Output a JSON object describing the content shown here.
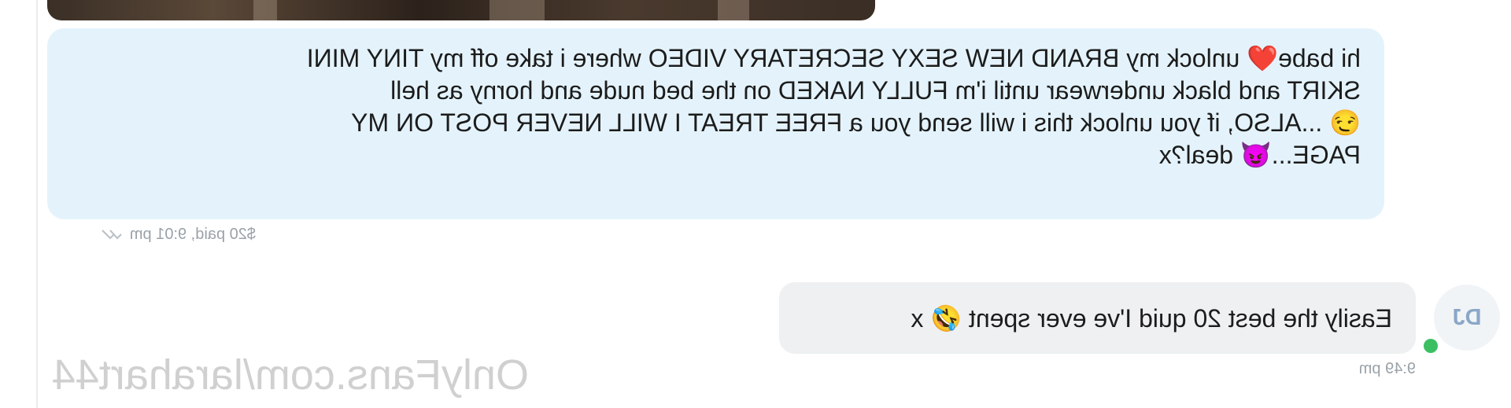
{
  "incoming_message": {
    "lines": [
      "hi babe❤️ unlock my BRAND NEW SEXY SECRETARY VIDEO where i take off my TINY MINI",
      "SKIRT and black underwear until i'm FULLY NAKED on the bed nude and horny as hell",
      "😏 ...ALSO, if you unlock this i will send you a FREE TREAT I WILL NEVER POST ON MY",
      "PAGE...😈 deal?x"
    ],
    "meta": "$20 paid, 9:01 pm"
  },
  "outgoing_message": {
    "text": "Easily the best 20 quid I've ever spent 🤣 x",
    "time": "9:49 pm",
    "avatar_initials": "DJ"
  },
  "watermark": "OnlyFans.com/larahart44",
  "colors": {
    "incoming_bubble": "#e4f3fb",
    "outgoing_bubble": "#eef0f1",
    "meta_text": "#9aa2a8",
    "online_dot": "#3cbf63",
    "avatar_text": "#8aa7c7"
  },
  "icons": {
    "read_receipt": "double-check-icon",
    "online_status": "status-dot-icon"
  }
}
